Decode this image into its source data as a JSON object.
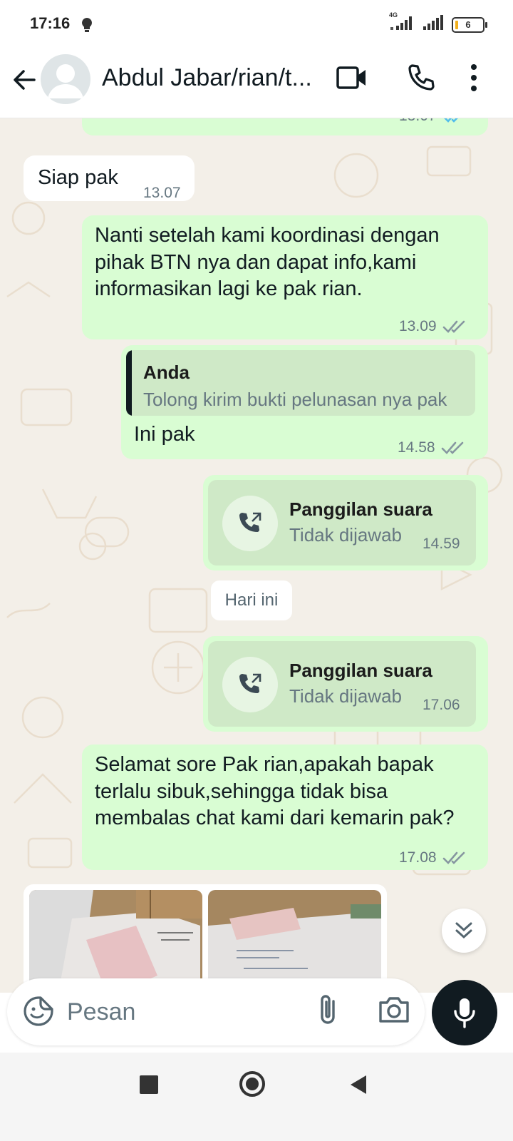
{
  "status_bar": {
    "time": "17:16",
    "network_label": "4G",
    "battery": "6"
  },
  "header": {
    "contact_name": "Abdul Jabar/rian/t..."
  },
  "messages": {
    "top_partial": {
      "time": "13.07"
    },
    "siap": {
      "text": "Siap pak",
      "time": "13.07"
    },
    "nanti": {
      "text": "Nanti setelah kami koordinasi dengan pihak BTN nya dan dapat info,kami informasikan lagi ke pak rian.",
      "time": "13.09"
    },
    "reply": {
      "quote_author": "Anda",
      "quote_text": "Tolong kirim bukti pelunasan nya pak",
      "text": "Ini pak",
      "time": "14.58"
    },
    "call1": {
      "title": "Panggilan suara",
      "status": "Tidak dijawab",
      "time": "14.59"
    },
    "date_divider": "Hari ini",
    "call2": {
      "title": "Panggilan suara",
      "status": "Tidak dijawab",
      "time": "17.06"
    },
    "selamat": {
      "text": "Selamat sore Pak rian,apakah bapak terlalu sibuk,sehingga tidak bisa membalas chat kami dari kemarin pak?",
      "time": "17.08"
    }
  },
  "composer": {
    "placeholder": "Pesan"
  },
  "colors": {
    "outgoing_bubble": "#d9fdd3",
    "incoming_bubble": "#ffffff",
    "chat_background": "#f3efe8",
    "read_tick": "#53bdeb",
    "mic_button": "#111b21"
  }
}
